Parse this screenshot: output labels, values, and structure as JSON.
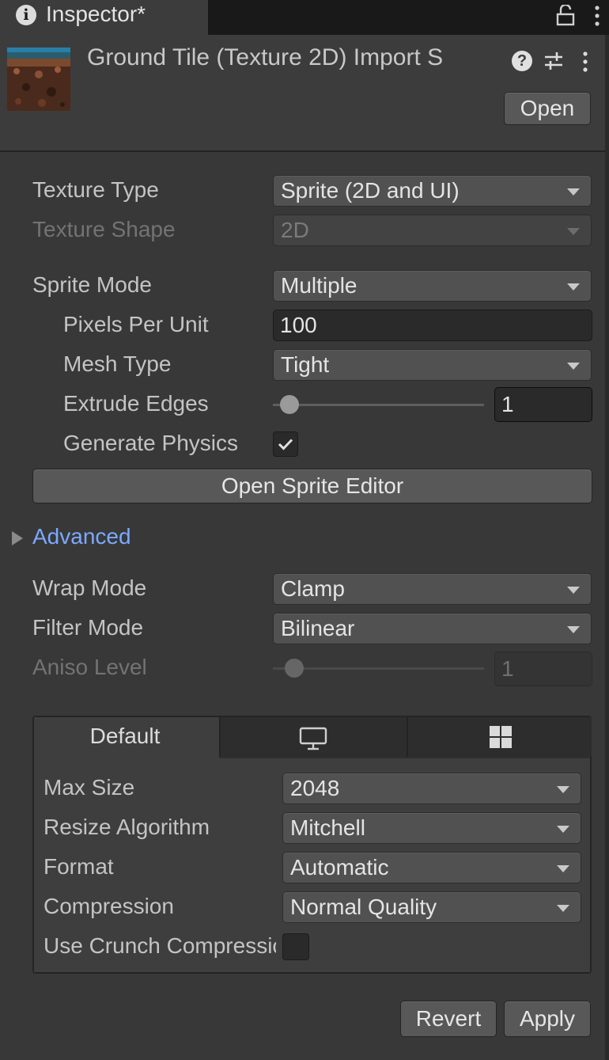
{
  "window": {
    "tab_title": "Inspector*"
  },
  "header": {
    "asset_title": "Ground Tile (Texture 2D) Import S",
    "open_label": "Open"
  },
  "texture": {
    "type_label": "Texture Type",
    "type_value": "Sprite (2D and UI)",
    "shape_label": "Texture Shape",
    "shape_value": "2D",
    "sprite_mode_label": "Sprite Mode",
    "sprite_mode_value": "Multiple",
    "ppu_label": "Pixels Per Unit",
    "ppu_value": "100",
    "mesh_type_label": "Mesh Type",
    "mesh_type_value": "Tight",
    "extrude_label": "Extrude Edges",
    "extrude_value": "1",
    "extrude_level": 0.08,
    "physics_label": "Generate Physics",
    "physics_checked": true,
    "sprite_editor_label": "Open Sprite Editor"
  },
  "advanced": {
    "label": "Advanced",
    "expanded": false
  },
  "wrap": {
    "label": "Wrap Mode",
    "value": "Clamp"
  },
  "filter": {
    "label": "Filter Mode",
    "value": "Bilinear"
  },
  "aniso": {
    "label": "Aniso Level",
    "value": "1",
    "level": 0.1
  },
  "platform": {
    "tabs": [
      {
        "label": "Default",
        "icon": null,
        "selected": true
      },
      {
        "label": "",
        "icon": "monitor-icon",
        "selected": false
      },
      {
        "label": "",
        "icon": "windows-icon",
        "selected": false
      }
    ],
    "max_size_label": "Max Size",
    "max_size_value": "2048",
    "resize_label": "Resize Algorithm",
    "resize_value": "Mitchell",
    "format_label": "Format",
    "format_value": "Automatic",
    "compression_label": "Compression",
    "compression_value": "Normal Quality",
    "crunch_label": "Use Crunch Compression",
    "crunch_checked": false
  },
  "footer": {
    "revert_label": "Revert",
    "apply_label": "Apply"
  },
  "colors": {
    "accent_link": "#7ba9ff",
    "background": "#383838",
    "button": "#585858"
  }
}
